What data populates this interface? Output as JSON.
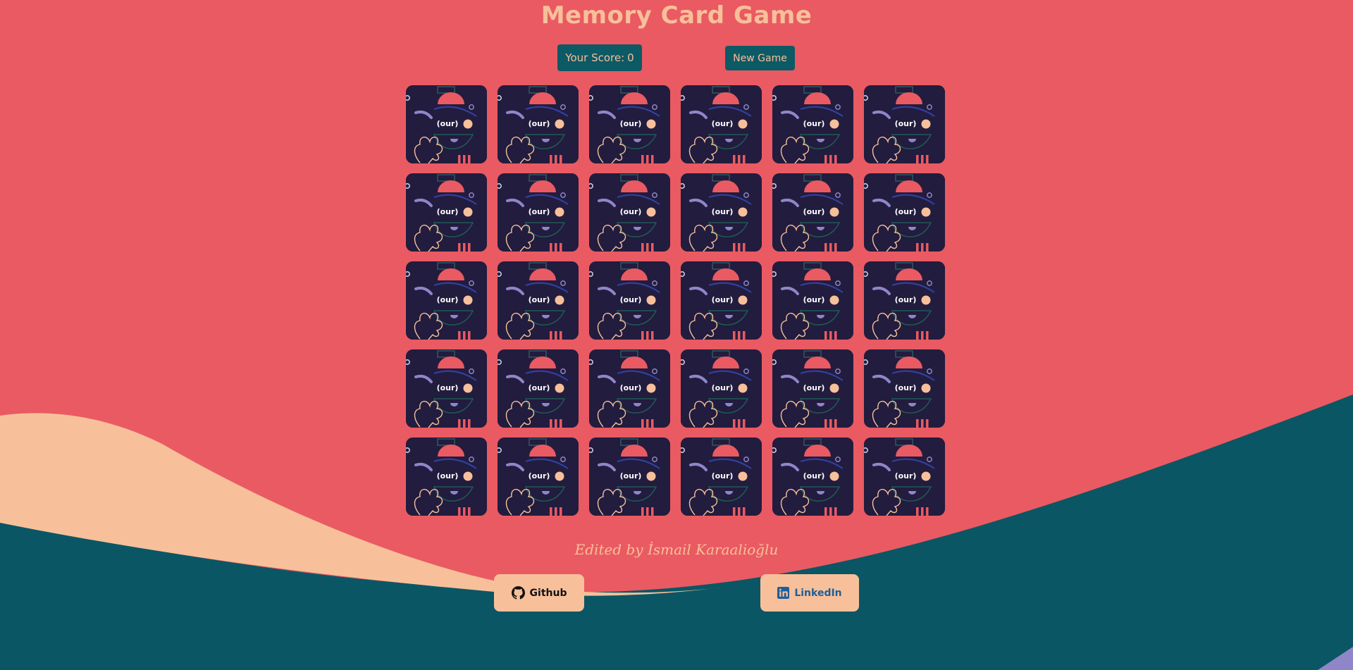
{
  "header": {
    "title": "Memory Card Game"
  },
  "score": {
    "label": "Your Score:",
    "value": "0"
  },
  "controls": {
    "new_game_label": "New Game"
  },
  "board": {
    "rows": 5,
    "columns": 6,
    "card_back_text": "(our)",
    "card_state": "face-down"
  },
  "footer": {
    "credit": "Edited by İsmail Karaalioğlu",
    "github_label": "Github",
    "github_icon": "github-icon",
    "linkedin_label": "LinkedIn",
    "linkedin_icon": "linkedin-icon"
  },
  "colors": {
    "background": "#ea5a62",
    "accent_peach": "#f7c09a",
    "accent_teal": "#0c5a66",
    "card_back": "#221c3e",
    "lavender": "#8f86c9"
  }
}
